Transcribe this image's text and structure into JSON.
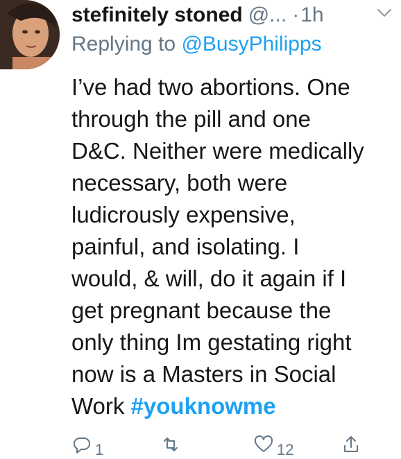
{
  "tweet": {
    "display_name": "stefinitely stoned",
    "handle": "@...",
    "separator": "·",
    "time": "1h",
    "replying_prefix": "Replying to",
    "replying_handle": "@BusyPhilipps",
    "body_lines": [
      "I’ve had two abortions. One",
      "through the pill and one",
      "D&C. Neither were medically",
      "necessary, both were",
      "ludicrously expensive,",
      "painful, and isolating. I",
      "would, & will, do it again if I",
      "get pregnant because the",
      "only thing Im gestating right",
      "now is a Masters in Social",
      "Work "
    ],
    "hashtag": "#youknowme",
    "actions": {
      "reply_count": "1",
      "retweet_count": "",
      "like_count": "12"
    }
  },
  "icons": {
    "avatar": "avatar-photo",
    "menu": "chevron-down-icon",
    "reply": "reply-icon",
    "retweet": "retweet-icon",
    "like": "heart-icon",
    "share": "share-icon"
  },
  "colors": {
    "text": "#14171a",
    "secondary": "#657786",
    "link": "#1da1f2",
    "background": "#ffffff"
  }
}
